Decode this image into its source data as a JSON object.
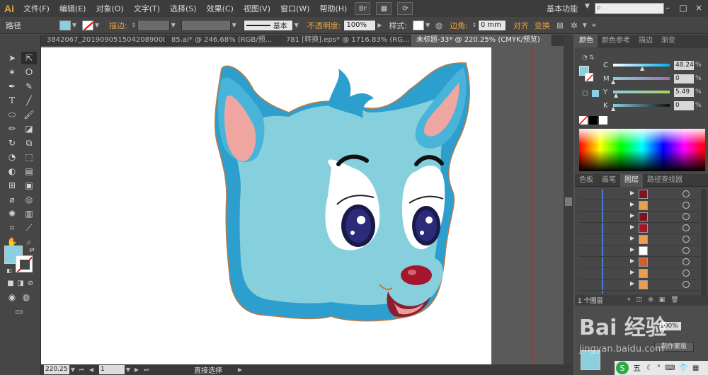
{
  "app": {
    "logo": "Ai",
    "menus": [
      "文件(F)",
      "编辑(E)",
      "对象(O)",
      "文字(T)",
      "选择(S)",
      "效果(C)",
      "视图(V)",
      "窗口(W)",
      "帮助(H)"
    ],
    "menu_icon_br": "Br",
    "workspace": "基本功能",
    "search_placeholder": ""
  },
  "control": {
    "object_label": "路径",
    "stroke_label": "描边:",
    "stroke_style": "基本",
    "opacity_label": "不透明度:",
    "opacity_value": "100%",
    "style_label": "样式:",
    "corner_label": "边角:",
    "corner_value": "0 mm",
    "align_label": "对齐",
    "transform_label": "变换",
    "fill_color": "#8ad0df"
  },
  "tabs": [
    {
      "label": "3842067_20190905150420890000.ai* ×",
      "active": false
    },
    {
      "label": "85.ai* @ 246.68% (RGB/预...",
      "active": false
    },
    {
      "label": "781 [转换].eps* @ 1716.83% (RG...",
      "active": false
    },
    {
      "label": "未标题-33* @ 220.25% (CMYK/预览)",
      "active": true
    }
  ],
  "panel": {
    "color_tabs": [
      "颜色",
      "颜色参考",
      "描边",
      "渐变"
    ],
    "sliders": [
      {
        "label": "C",
        "value": "48.24",
        "pct": 48
      },
      {
        "label": "M",
        "value": "0",
        "pct": 0
      },
      {
        "label": "Y",
        "value": "5.49",
        "pct": 5
      },
      {
        "label": "K",
        "value": "0",
        "pct": 0
      }
    ],
    "pct_sign": "%",
    "layer_tabs": [
      "色板",
      "画笔",
      "图层",
      "路径查找器"
    ],
    "layers_count": "1 个图层",
    "make_mask": "制作蒙版",
    "layer_count_rows": 9
  },
  "status": {
    "zoom": "220.25",
    "page": "1",
    "tool": "直接选择"
  },
  "watermark": {
    "brand": "Bai 经验",
    "url": "jingyan.baidu.com"
  },
  "taskbar": {
    "ime": "五"
  }
}
